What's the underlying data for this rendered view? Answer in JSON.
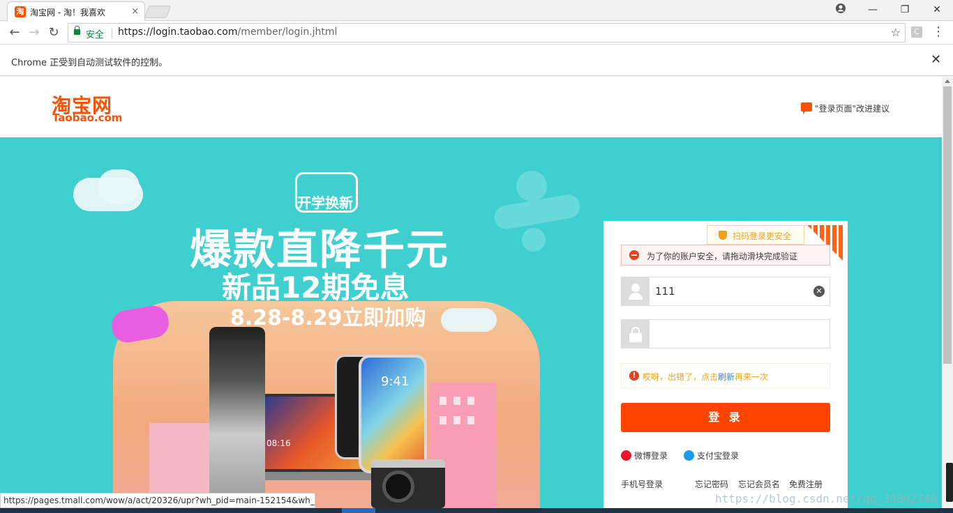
{
  "browser": {
    "tab": {
      "favicon_text": "淘",
      "title": "淘宝网 - 淘！我喜欢",
      "close": "×"
    },
    "window_controls": {
      "account": "account-icon",
      "minimize": "—",
      "restore": "❐",
      "close": "✕"
    },
    "nav": {
      "back": "←",
      "forward": "→",
      "reload": "↻"
    },
    "address": {
      "secure_label": "安全",
      "url_host": "https://login.taobao.com",
      "url_path": "/member/login.jhtml",
      "bookmark": "☆"
    },
    "extension_label": "C",
    "menu": "⋮"
  },
  "infobar": {
    "message": "Chrome 正受到自动测试软件的控制。",
    "close": "✕"
  },
  "header": {
    "logo_cn": "淘宝网",
    "logo_en": "Taobao.com",
    "feedback": "\"登录页面\"改进建议"
  },
  "banner": {
    "badge": "开学换新",
    "line1": "爆款直降千元",
    "line2": "新品12期免息",
    "line3": "8.28-8.29立即加购",
    "phone_time": "9:41",
    "laptop_time": "08:16"
  },
  "login": {
    "qr_tip": "扫码登录更安全",
    "alert": "为了你的账户安全，请拖动滑块完成验证",
    "username_value": "111",
    "password_placeholder": "",
    "error_prefix": "哎呀，出错了，点击",
    "error_link": "刷新",
    "error_suffix": "再来一次",
    "submit": "登 录",
    "weibo": "微博登录",
    "alipay": "支付宝登录",
    "phone_login": "手机号登录",
    "forgot_password": "忘记密码",
    "forgot_member": "忘记会员名",
    "register": "免费注册"
  },
  "status_url": "https://pages.tmall.com/wow/a/act/20326/upr?wh_pid=main-152154&wh_...",
  "watermark": "https://blog.csdn.net/qq_39802740",
  "colors": {
    "brand": "#ff5000",
    "banner_bg": "#3fcfcf",
    "login_button": "#ff4400",
    "secure_green": "#0b8043"
  }
}
